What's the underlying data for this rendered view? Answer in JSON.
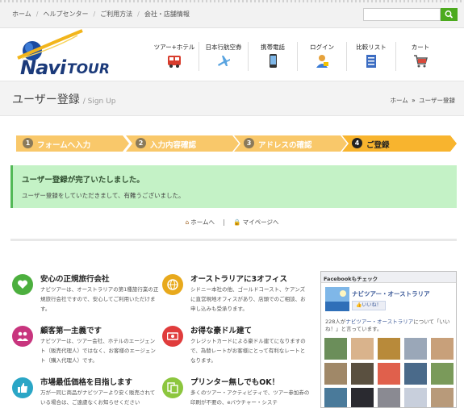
{
  "top_nav": {
    "breadcrumbs": [
      "ホーム",
      "ヘルプセンター",
      "ご利用方法",
      "会社・店舗情報"
    ],
    "search_placeholder": ""
  },
  "logo": {
    "navi": "Navi",
    "tour": "TOUR"
  },
  "main_nav": [
    {
      "label": "ツアー+ホテル",
      "icon": "bus-icon"
    },
    {
      "label": "日本行航空券",
      "icon": "airplane-icon"
    },
    {
      "label": "携帯電話",
      "icon": "mobile-phone-icon"
    },
    {
      "label": "ログイン",
      "icon": "user-icon"
    },
    {
      "label": "比較リスト",
      "icon": "list-icon"
    },
    {
      "label": "カート",
      "icon": "cart-icon"
    }
  ],
  "page_header": {
    "title": "ユーザー登録",
    "subtitle": "/ Sign Up",
    "breadcrumb_home": "ホーム",
    "breadcrumb_current": "ユーザー登録"
  },
  "steps": [
    {
      "num": "1",
      "label": "フォームへ入力",
      "active": false
    },
    {
      "num": "2",
      "label": "入力内容確認",
      "active": false
    },
    {
      "num": "3",
      "label": "アドレスの確認",
      "active": false
    },
    {
      "num": "4",
      "label": "ご登録",
      "active": true
    }
  ],
  "alert": {
    "title": "ユーザー登録が完了いたしました。",
    "message": "ユーザー登録をしていただきまして、有難うございました。"
  },
  "links": {
    "home": "ホームへ",
    "mypage": "マイページへ"
  },
  "features": [
    {
      "title": "安心の正規旅行会社",
      "desc": "ナビツアーは、オーストラリアの第1種旅行業の正規旅行会社ですので、安心してご利用いただけます。",
      "color": "#4caf3e",
      "icon": "heart-icon"
    },
    {
      "title": "オーストラリアに3オフィス",
      "desc": "シドニー本社の他、ゴールドコースト、ケアンズに直営現地オフィスがあり、店頭でのご相談、お申し込みも受承ります。",
      "color": "#e8a91c",
      "icon": "globe-icon"
    },
    {
      "title": "顧客第一主義です",
      "desc": "ナビツアーは、ツアー会社、ホテルのエージェント（販売代理人）ではなく、お客様のエージェント（購入代理人）です。",
      "color": "#c8357e",
      "icon": "people-icon"
    },
    {
      "title": "お得な豪ドル建て",
      "desc": "クレジットカードによる豪ドル建てになりますので、為替レートがお客様にとって有利なレートとなります。",
      "color": "#e03c3c",
      "icon": "money-icon"
    },
    {
      "title": "市場最低価格を目指します",
      "desc": "万が一同じ商品がナビツアーより安く販売されている場合は、ご遠慮なくお知らせください",
      "color": "#2aa6c6",
      "icon": "thumbs-up-icon"
    },
    {
      "title": "プリンター無しでもOK！",
      "desc": "多くのツアー・アクティビティで、ツアー参加券の印刷が不要の、eバウチャー・システ",
      "color": "#8cc63e",
      "icon": "copy-icon"
    }
  ],
  "facebook": {
    "header": "Facebookもチェック",
    "page_name": "ナビツアー・オーストラリア",
    "like_button": "いいね！",
    "count_prefix": "228人が",
    "count_link": "ナビツアー・オーストラリア",
    "count_suffix": "について「いいね！」と言っています。"
  },
  "colors": {
    "step_bg": "#f9c86a",
    "step_active_bg": "#f8b42e",
    "alert_bg": "#c4f2c6",
    "search_button": "#4caa1e"
  }
}
